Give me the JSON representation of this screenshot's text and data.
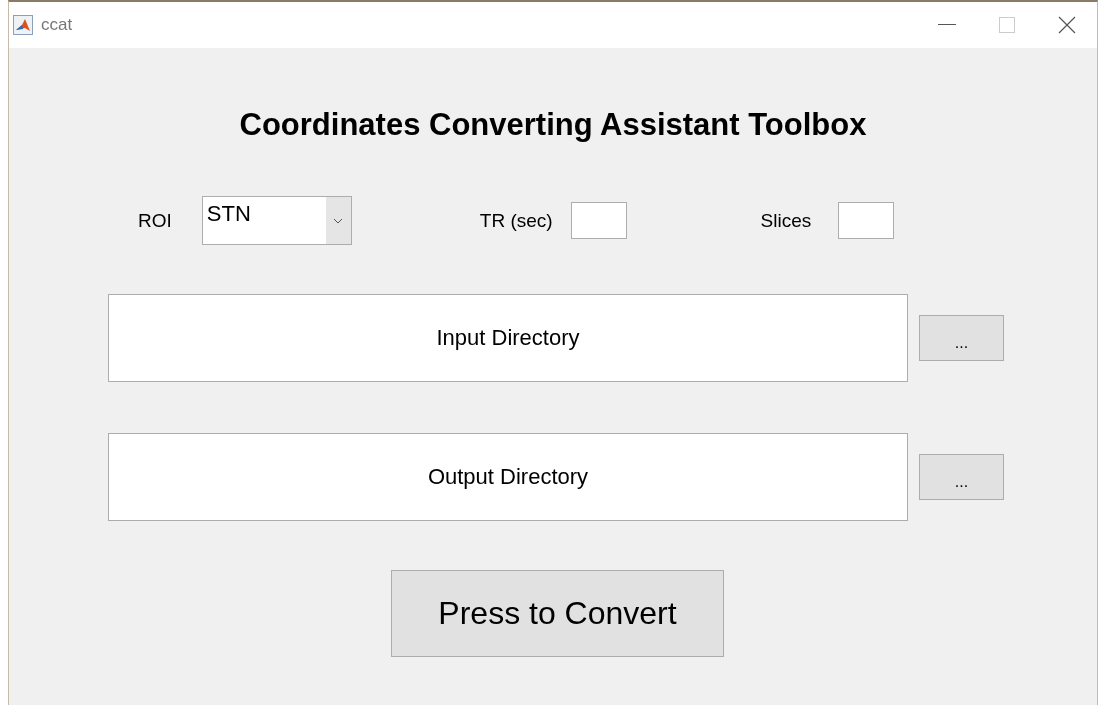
{
  "window": {
    "title": "ccat"
  },
  "heading": "Coordinates Converting Assistant Toolbox",
  "roi": {
    "label": "ROI",
    "value": "STN"
  },
  "tr": {
    "label": "TR (sec)"
  },
  "slices": {
    "label": "Slices"
  },
  "directories": [
    {
      "label": "Input Directory",
      "browse": "..."
    },
    {
      "label": "Output Directory",
      "browse": "..."
    }
  ],
  "convert_button": "Press to Convert"
}
